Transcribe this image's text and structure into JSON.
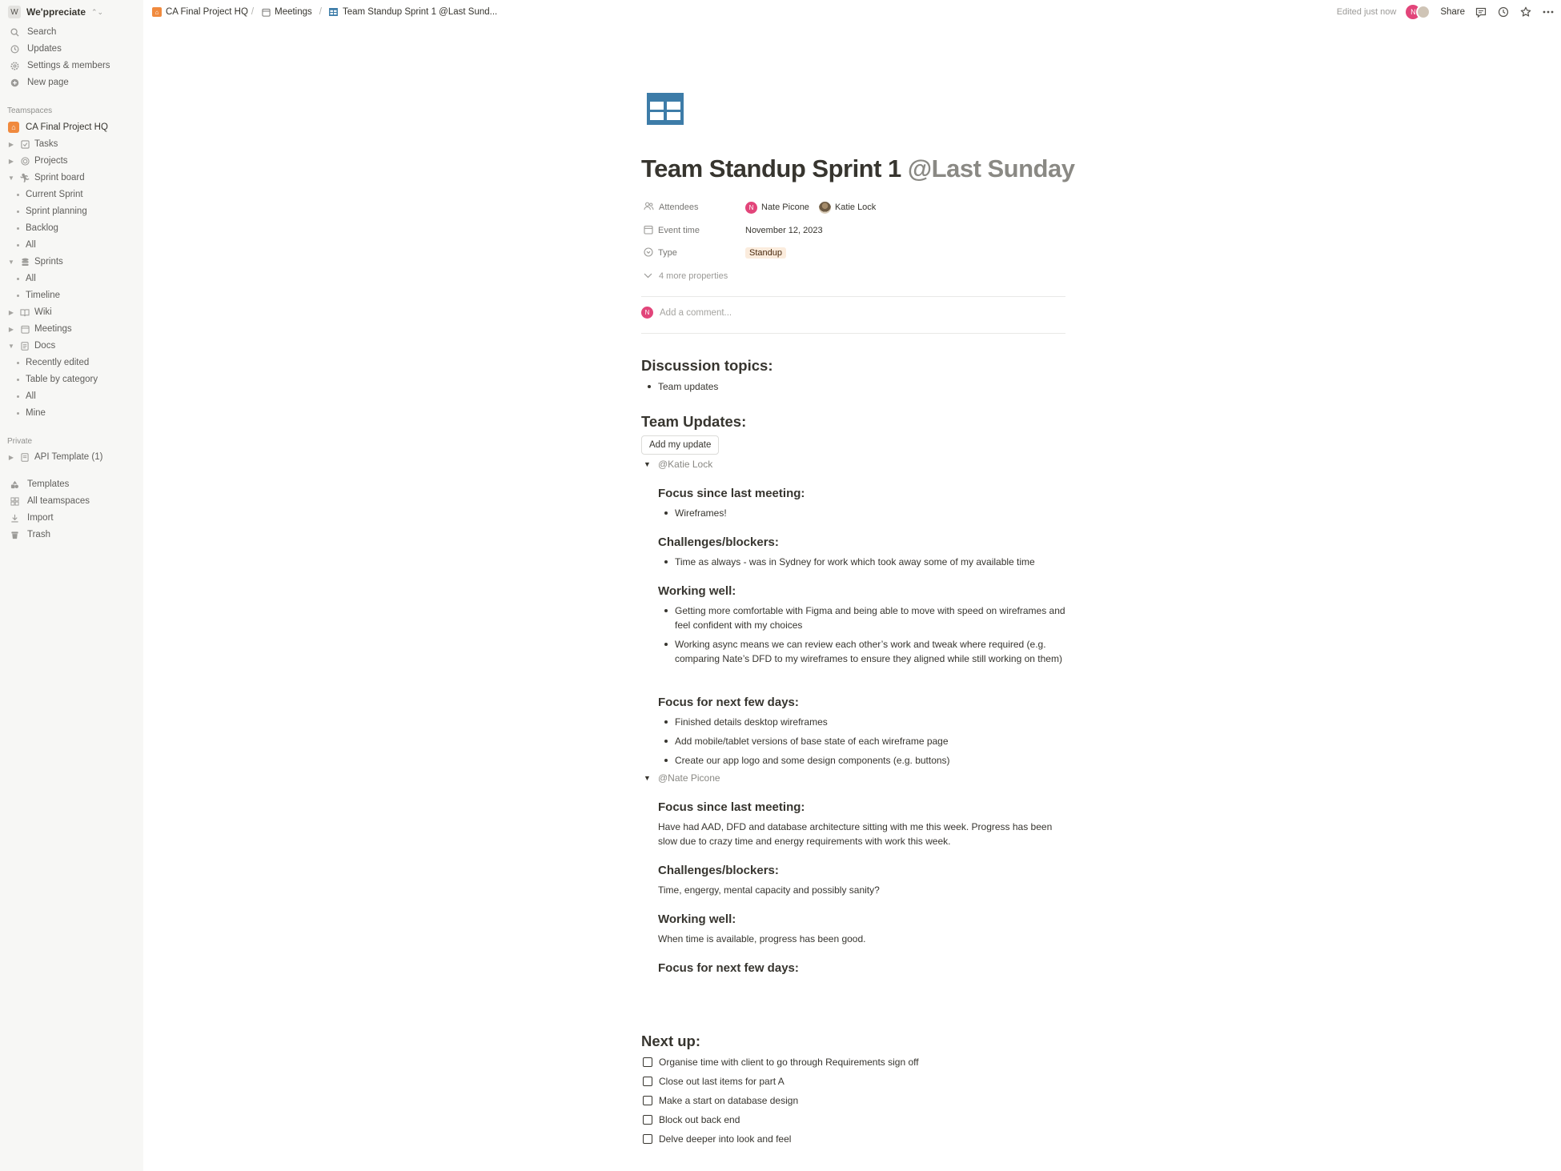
{
  "workspace": {
    "badge": "W",
    "name": "We'ppreciate"
  },
  "sidebar": {
    "top_items": [
      {
        "label": "Search",
        "icon": "search-icon"
      },
      {
        "label": "Updates",
        "icon": "clock-icon"
      },
      {
        "label": "Settings & members",
        "icon": "gear-icon"
      },
      {
        "label": "New page",
        "icon": "plus-circle-icon"
      }
    ],
    "teamspaces_label": "Teamspaces",
    "teamspace_name": "CA Final Project HQ",
    "tree": {
      "tasks": "Tasks",
      "projects": "Projects",
      "sprint_board": "Sprint board",
      "current_sprint": "Current Sprint",
      "sprint_planning": "Sprint planning",
      "backlog": "Backlog",
      "sprint_board_all": "All",
      "sprints": "Sprints",
      "sprints_all": "All",
      "timeline": "Timeline",
      "wiki": "Wiki",
      "meetings": "Meetings",
      "docs": "Docs",
      "recently_edited": "Recently edited",
      "table_by_category": "Table by category",
      "docs_all": "All",
      "mine": "Mine"
    },
    "private_label": "Private",
    "private_page": "API Template (1)",
    "bottom_items": [
      {
        "label": "Templates",
        "icon": "templates-icon"
      },
      {
        "label": "All teamspaces",
        "icon": "grid-icon"
      },
      {
        "label": "Import",
        "icon": "download-icon"
      },
      {
        "label": "Trash",
        "icon": "trash-icon"
      }
    ]
  },
  "topbar": {
    "breadcrumbs": [
      "CA Final Project HQ",
      "Meetings",
      "Team Standup Sprint 1 @Last Sund..."
    ],
    "edited": "Edited just now",
    "avatar_initial": "N",
    "share": "Share"
  },
  "page": {
    "title": "Team Standup Sprint 1",
    "title_mention": "@Last Sunday",
    "properties": {
      "attendees_label": "Attendees",
      "attendees": [
        {
          "initial": "N",
          "name": "Nate Picone"
        },
        {
          "initial": "K",
          "name": "Katie Lock"
        }
      ],
      "event_time_label": "Event time",
      "event_time": "November 12, 2023",
      "type_label": "Type",
      "type": "Standup",
      "more": "4 more properties"
    },
    "comment_avatar": "N",
    "comment_placeholder": "Add a comment...",
    "discussion_heading": "Discussion topics:",
    "discussion_items": [
      "Team updates"
    ],
    "team_updates_heading": "Team Updates:",
    "add_update_button": "Add my update",
    "katie": {
      "mention": "@Katie Lock",
      "focus_heading": "Focus since last meeting:",
      "focus_items": [
        "Wireframes!"
      ],
      "challenges_heading": "Challenges/blockers:",
      "challenges_items": [
        "Time as always - was in Sydney for work which took away some of my available time"
      ],
      "working_heading": "Working well:",
      "working_items": [
        "Getting more comfortable with Figma and being able to move with speed on wireframes and feel confident with my choices",
        "Working async means we can review each other’s work and tweak where required (e.g. comparing Nate’s DFD to my wireframes to ensure they aligned while still working on them)"
      ],
      "next_heading": "Focus for next few days:",
      "next_items": [
        "Finished details desktop wireframes",
        "Add mobile/tablet versions of base state of each wireframe page",
        "Create our app logo and some design components (e.g. buttons)"
      ]
    },
    "nate": {
      "mention": "@Nate Picone",
      "focus_heading": "Focus since last meeting:",
      "focus_text": "Have had AAD, DFD and database architecture sitting with me this week. Progress has been slow due to crazy time and energy requirements with work this week.",
      "challenges_heading": "Challenges/blockers:",
      "challenges_text": "Time, engergy, mental capacity and possibly sanity?",
      "working_heading": "Working well:",
      "working_text": "When time is available, progress has been good.",
      "next_heading": "Focus for next few days:"
    },
    "next_up_heading": "Next up:",
    "todos": [
      "Organise time with client to go through Requirements sign off",
      "Close out last items for part A",
      "Make a start on database design",
      "Block out back end",
      "Delve deeper into look and feel"
    ]
  },
  "colors": {
    "sidebar_bg": "#f7f7f5",
    "accent_home": "#f08a3e",
    "avatar_pink": "#e2457a",
    "page_icon_blue": "#3d7ca8",
    "tag_bg": "#fbecdd"
  }
}
